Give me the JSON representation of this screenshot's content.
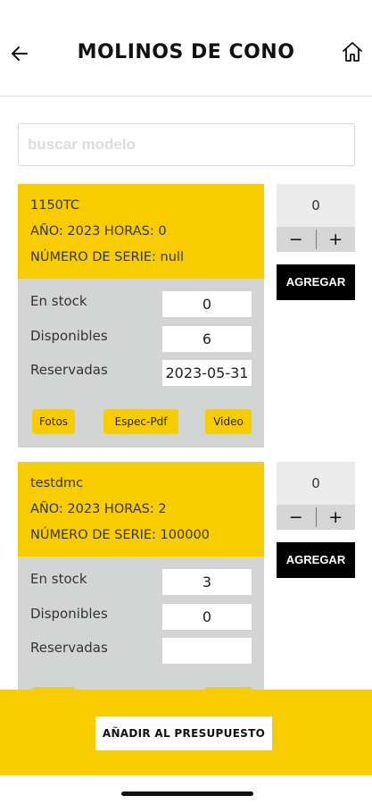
{
  "header": {
    "title": "MOLINOS DE CONO",
    "back_icon": "arrow-left-icon",
    "home_icon": "home-icon"
  },
  "search": {
    "placeholder": "buscar modelo",
    "value": ""
  },
  "products": [
    {
      "model": "1150TC",
      "year_hours": "AÑO: 2023 HORAS: 0",
      "serial": "NÚMERO DE SERIE: null",
      "stock_label": "En stock",
      "stock_value": "0",
      "available_label": "Disponibles",
      "available_value": "6",
      "reserved_label": "Reservadas",
      "reserved_value": "2023-05-31",
      "buttons": {
        "photos": "Fotos",
        "spec_pdf": "Espec-Pdf",
        "video": "Video"
      },
      "quantity": "0",
      "minus": "−",
      "plus": "+",
      "add_label": "AGREGAR"
    },
    {
      "model": "testdmc",
      "year_hours": "AÑO: 2023 HORAS: 2",
      "serial": "NÚMERO DE SERIE: 100000",
      "stock_label": "En stock",
      "stock_value": "3",
      "available_label": "Disponibles",
      "available_value": "0",
      "reserved_label": "Reservadas",
      "reserved_value": "",
      "quantity": "0",
      "minus": "−",
      "plus": "+",
      "add_label": "AGREGAR"
    }
  ],
  "footer": {
    "budget_label": "AÑADIR AL PRESUPUESTO"
  },
  "colors": {
    "accent_yellow": "#f8cd00",
    "card_gray": "#d3d5d4",
    "add_button": "#000000"
  }
}
